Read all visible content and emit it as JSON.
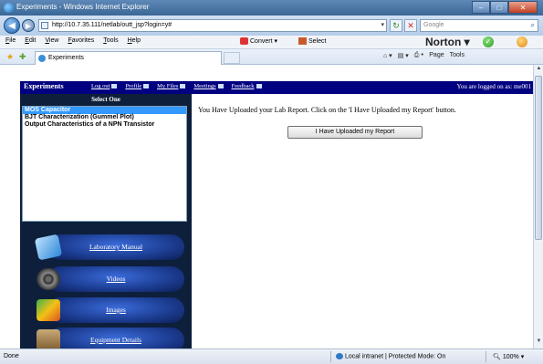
{
  "window": {
    "title": "Experiments - Windows Internet Explorer",
    "min": "–",
    "max": "□",
    "close": "✕"
  },
  "address": {
    "url": "http://10.7.35.111/netlab/outt_jsp?login=y#",
    "search_placeholder": "Google"
  },
  "menu": [
    "File",
    "Edit",
    "View",
    "Favorites",
    "Tools",
    "Help"
  ],
  "toolbar": {
    "convert": "Convert",
    "select": "Select",
    "norton": "Norton",
    "command_items": [
      "Page",
      "Tools"
    ]
  },
  "tab": {
    "title": "Experiments"
  },
  "topnav": {
    "brand": "Experiments",
    "links": [
      "Log out",
      "Profile",
      "My Files",
      "Meetings",
      "Feedback"
    ],
    "logged_in": "You are logged on as: me001"
  },
  "left": {
    "heading": "Select One",
    "experiments": [
      "MOS Capacitor",
      "BJT Characterization (Gummel Plot)",
      "Output Characteristics of a NPN Transistor"
    ],
    "selected_index": 0,
    "menu": [
      "Laboratory Manual",
      "Videos",
      "Images",
      "Equipment Details"
    ]
  },
  "main": {
    "message": "You Have Uploaded your Lab Report. Click on the 'I Have Uploaded my Report' button.",
    "button": "I Have Uploaded my Report"
  },
  "status": {
    "left": "Done",
    "zone": "Local intranet | Protected Mode: On",
    "zoom": "100%"
  },
  "colors": {
    "nav_bg": "#000080",
    "selected": "#3399ff",
    "panel_bg": "#0e1f3b"
  }
}
